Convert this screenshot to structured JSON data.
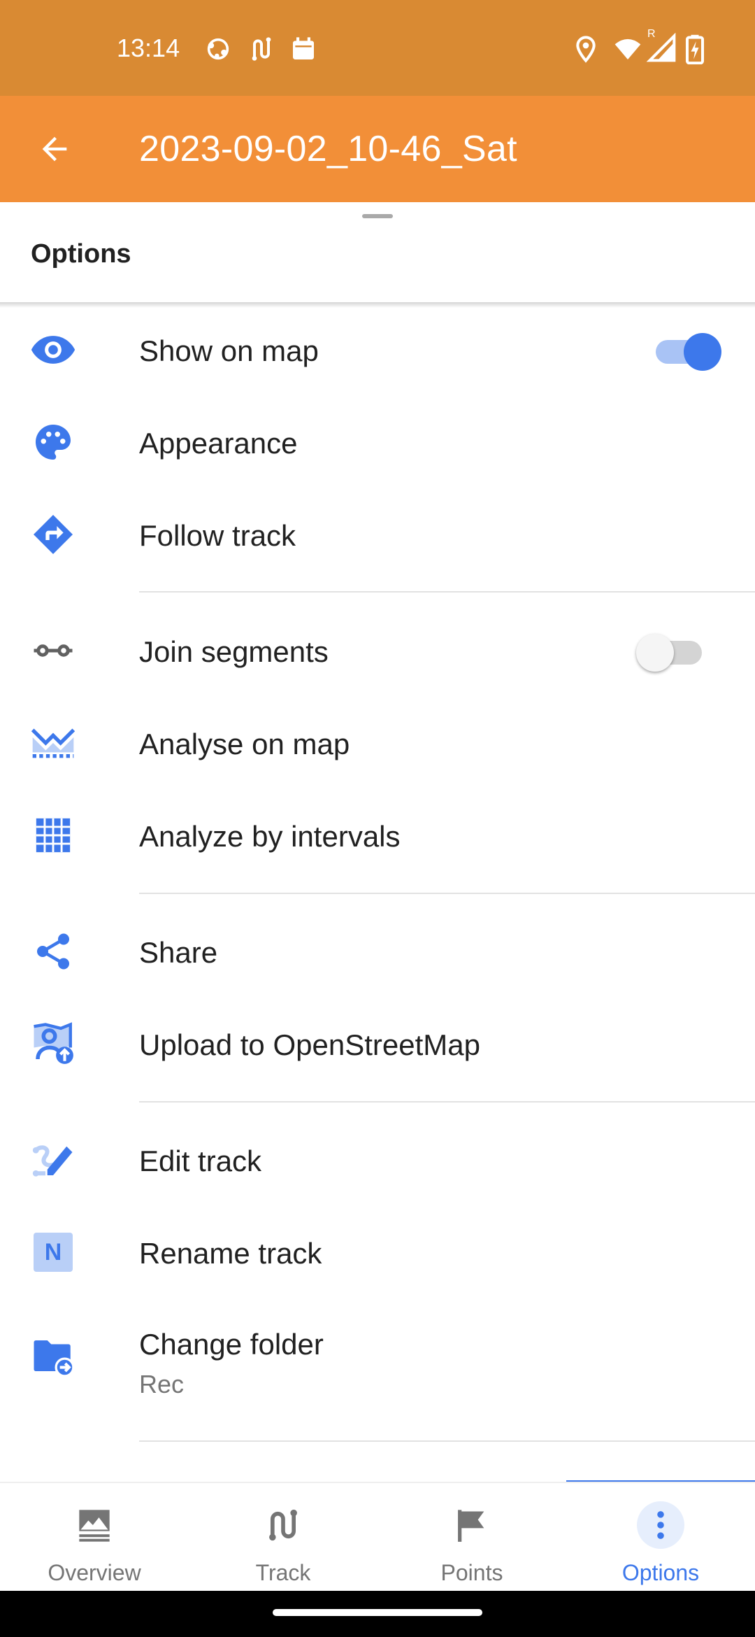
{
  "status_bar": {
    "time": "13:14",
    "icons": [
      "vpn-globe-icon",
      "route-icon",
      "calendar-icon",
      "location-icon",
      "wifi-icon",
      "signal-icon",
      "battery-charging-icon"
    ],
    "signal_label": "R",
    "color": "#d98a33"
  },
  "app_bar": {
    "title": "2023-09-02_10-46_Sat",
    "back_icon": "arrow-back-icon",
    "color": "#f28f38"
  },
  "sheet": {
    "title": "Options"
  },
  "options": {
    "show_on_map": {
      "label": "Show on map",
      "icon": "eye-icon",
      "toggle": true
    },
    "appearance": {
      "label": "Appearance",
      "icon": "palette-icon"
    },
    "follow_track": {
      "label": "Follow track",
      "icon": "directions-icon"
    },
    "join_segments": {
      "label": "Join segments",
      "icon": "segments-icon",
      "toggle": false
    },
    "analyse_on_map": {
      "label": "Analyse on map",
      "icon": "chart-area-icon"
    },
    "analyze_intervals": {
      "label": "Analyze by intervals",
      "icon": "grid-icon"
    },
    "share": {
      "label": "Share",
      "icon": "share-icon"
    },
    "upload_osm": {
      "label": "Upload to OpenStreetMap",
      "icon": "osm-upload-icon"
    },
    "edit_track": {
      "label": "Edit track",
      "icon": "edit-track-icon"
    },
    "rename_track": {
      "label": "Rename track",
      "icon": "rename-n-icon",
      "icon_letter": "N"
    },
    "change_folder": {
      "label": "Change folder",
      "sub": "Rec",
      "icon": "folder-move-icon"
    }
  },
  "bottom_nav": {
    "items": [
      {
        "label": "Overview",
        "icon": "image-landscape-icon"
      },
      {
        "label": "Track",
        "icon": "route-icon"
      },
      {
        "label": "Points",
        "icon": "flag-icon"
      },
      {
        "label": "Options",
        "icon": "more-vert-icon"
      }
    ],
    "active": "Options",
    "accent": "#3d78eb"
  }
}
